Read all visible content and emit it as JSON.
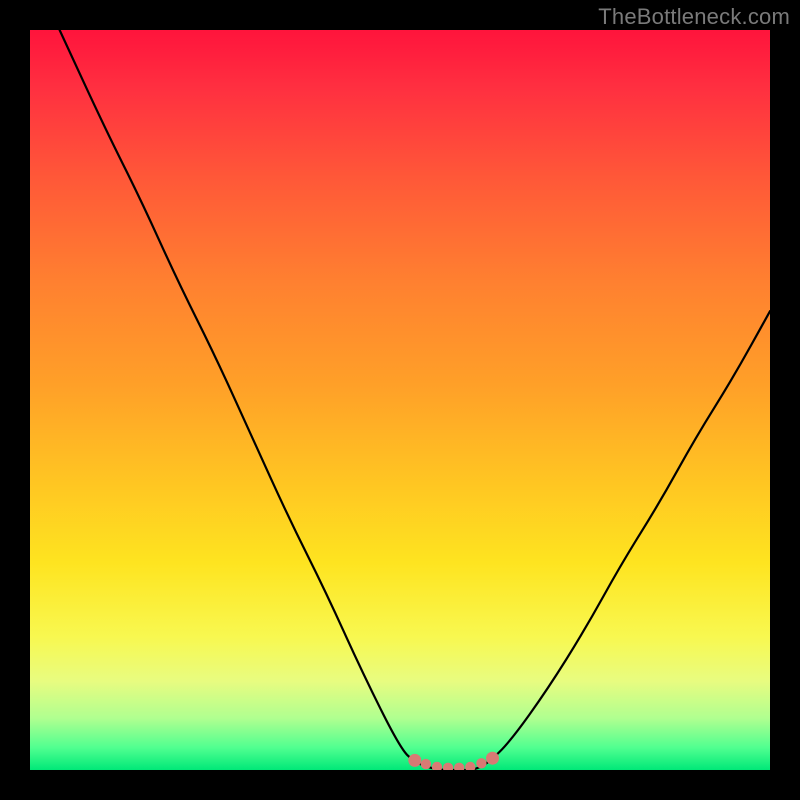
{
  "watermark": "TheBottleneck.com",
  "colors": {
    "frame": "#000000",
    "curve": "#000000",
    "marker": "#d87a74",
    "gradient_top": "#ff143c",
    "gradient_bottom": "#00e878"
  },
  "chart_data": {
    "type": "line",
    "title": "",
    "xlabel": "",
    "ylabel": "",
    "xlim": [
      0,
      100
    ],
    "ylim": [
      0,
      100
    ],
    "grid": false,
    "legend": false,
    "series": [
      {
        "name": "bottleneck-curve",
        "x": [
          4,
          10,
          15,
          20,
          25,
          30,
          35,
          40,
          45,
          50,
          52,
          55,
          58,
          60,
          62,
          65,
          70,
          75,
          80,
          85,
          90,
          95,
          100
        ],
        "y": [
          100,
          87,
          77,
          66,
          56,
          45,
          34,
          24,
          13,
          3,
          1,
          0,
          0,
          0,
          1,
          4,
          11,
          19,
          28,
          36,
          45,
          53,
          62
        ]
      }
    ],
    "markers": {
      "name": "optimal-range",
      "color": "#d87a74",
      "points_x": [
        52,
        53.5,
        55,
        56.5,
        58,
        59.5,
        61,
        62.5
      ],
      "points_y": [
        1.3,
        0.8,
        0.4,
        0.3,
        0.3,
        0.4,
        0.9,
        1.6
      ]
    }
  }
}
